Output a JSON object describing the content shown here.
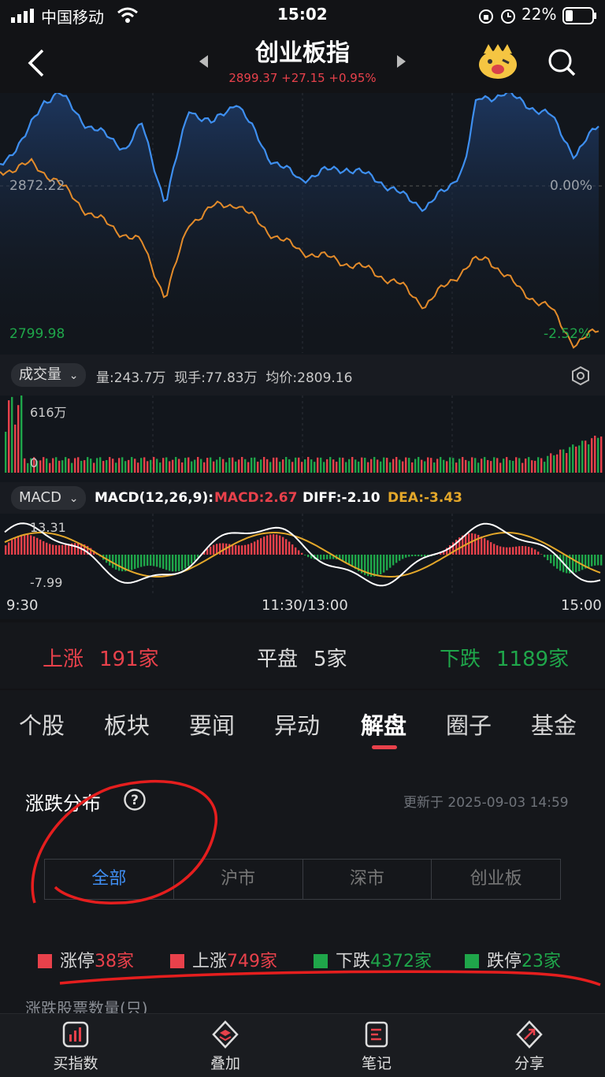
{
  "status": {
    "carrier": "中国移动",
    "time": "15:02",
    "battery": "22%"
  },
  "header": {
    "title": "创业板指",
    "quote": "2899.37 +27.15 +0.95%"
  },
  "chart": {
    "y_top_label": "2872.22",
    "y_bottom_label": "2799.98",
    "pct_mid": "0.00%",
    "pct_bottom": "-2.52%",
    "volume_pill": "成交量",
    "volume_info": "量:243.7万  现手:77.83万  均价:2809.16",
    "volume_max": "616万",
    "volume_zero": "0",
    "macd_pill": "MACD",
    "macd_params": "MACD(12,26,9):",
    "macd_value": "MACD:2.67",
    "diff_value": "DIFF:-2.10",
    "dea_value": "DEA:-3.43",
    "macd_top": "13.31",
    "macd_bottom": "-7.99",
    "time_start": "9:30",
    "time_mid": "11:30/13:00",
    "time_end": "15:00"
  },
  "breadth": {
    "up_label": "上涨",
    "up_count": "191家",
    "flat_label": "平盘",
    "flat_count": "5家",
    "down_label": "下跌",
    "down_count": "1189家"
  },
  "tabs": [
    "个股",
    "板块",
    "要闻",
    "异动",
    "解盘",
    "圈子",
    "基金"
  ],
  "section": {
    "title": "涨跌分布",
    "updated": "更新于 2025-09-03 14:59",
    "segments": [
      "全部",
      "沪市",
      "深市",
      "创业板"
    ],
    "legend": [
      {
        "label": "涨停",
        "count": "38家",
        "color": "#e8414b"
      },
      {
        "label": "上涨",
        "count": "749家",
        "color": "#e8414b"
      },
      {
        "label": "下跌",
        "count": "4372家",
        "color": "#1fa64a"
      },
      {
        "label": "跌停",
        "count": "23家",
        "color": "#1fa64a"
      }
    ],
    "partial_label": "涨跌股票数量(只)"
  },
  "bottom_bar": [
    "买指数",
    "叠加",
    "笔记",
    "分享"
  ],
  "colors": {
    "up": "#e8414b",
    "down": "#1fa64a",
    "accent": "#3f8ef2",
    "line_blue": "#3e8ff0",
    "line_orange": "#e38b2a"
  }
}
